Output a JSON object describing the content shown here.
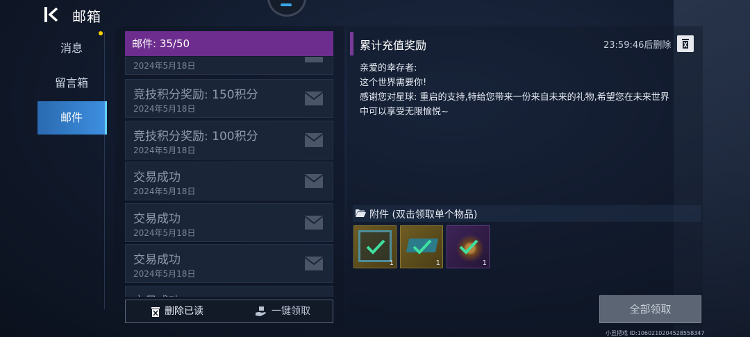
{
  "header": {
    "title": "邮箱",
    "back_icon": "back-arrow-icon"
  },
  "sidebar": {
    "items": [
      {
        "label": "消息",
        "active": false
      },
      {
        "label": "留言箱",
        "active": false
      },
      {
        "label": "邮件",
        "active": true
      }
    ]
  },
  "mail": {
    "count_label": "邮件: 35/50",
    "items": [
      {
        "title": "",
        "date": "2024年5月18日"
      },
      {
        "title": "竞技积分奖励: 150积分",
        "date": "2024年5月18日"
      },
      {
        "title": "竞技积分奖励: 100积分",
        "date": "2024年5月18日"
      },
      {
        "title": "交易成功",
        "date": "2024年5月18日"
      },
      {
        "title": "交易成功",
        "date": "2024年5月18日"
      },
      {
        "title": "交易成功",
        "date": "2024年5月18日"
      },
      {
        "title": "交易成功",
        "date": ""
      }
    ],
    "delete_read_label": "删除已读",
    "claim_all_list_label": "一键领取"
  },
  "detail": {
    "title": "累计充值奖励",
    "expiry": "23:59:46后删除",
    "body": {
      "line1": "亲爱的幸存者:",
      "line2": "这个世界需要你!",
      "line3": "感谢您对星球: 重启的支持,特给您带来一份来自未来的礼物,希望您在未来世界",
      "line4": "中可以享受无限愉悦~"
    },
    "attachments_label": "附件 (双击领取单个物品)",
    "attachments": [
      {
        "name": "frame-item",
        "qty": "1",
        "claimed": true
      },
      {
        "name": "ticket-item",
        "qty": "1",
        "claimed": true
      },
      {
        "name": "plant-item",
        "qty": "1",
        "claimed": true
      }
    ],
    "claim_all_label": "全部领取"
  },
  "footer": {
    "text": "小丑把戏 ID:1060210204528558347"
  },
  "colors": {
    "accent_purple": "#6d2d8e",
    "active_blue": "#3d8fe0",
    "check_green": "#3fe0a0"
  }
}
